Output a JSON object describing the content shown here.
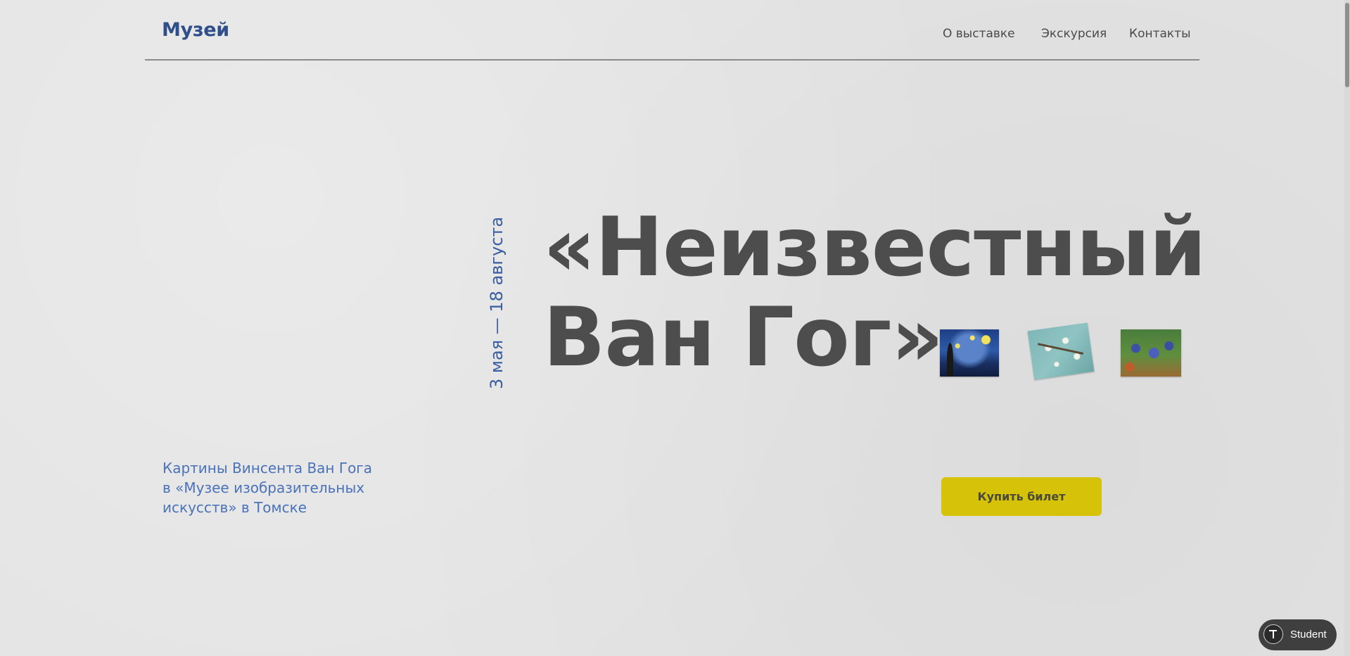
{
  "header": {
    "logo": "Музей",
    "nav": [
      {
        "label": "О выставке"
      },
      {
        "label": "Экскурсия"
      },
      {
        "label": "Контакты"
      }
    ]
  },
  "hero": {
    "date": "3 мая — 18 августа",
    "title_line1": "«Неизвестный",
    "title_line2": "Ван Гог»",
    "paintings": [
      {
        "name": "starry-night"
      },
      {
        "name": "almond-blossom"
      },
      {
        "name": "irises"
      }
    ]
  },
  "subtitle": {
    "line1": "Картины Винсента Ван Гога",
    "line2": "в «Музее изобразительных",
    "line3": "искусств» в Томске"
  },
  "buy_button": {
    "label": "Купить билет"
  },
  "badge": {
    "label": "Student"
  },
  "colors": {
    "background": "#e3e3e3",
    "brand_blue": "#2f4f8a",
    "accent_blue": "#4a72b8",
    "title_gray": "#4d4d4d",
    "button_yellow": "#d6c309"
  }
}
